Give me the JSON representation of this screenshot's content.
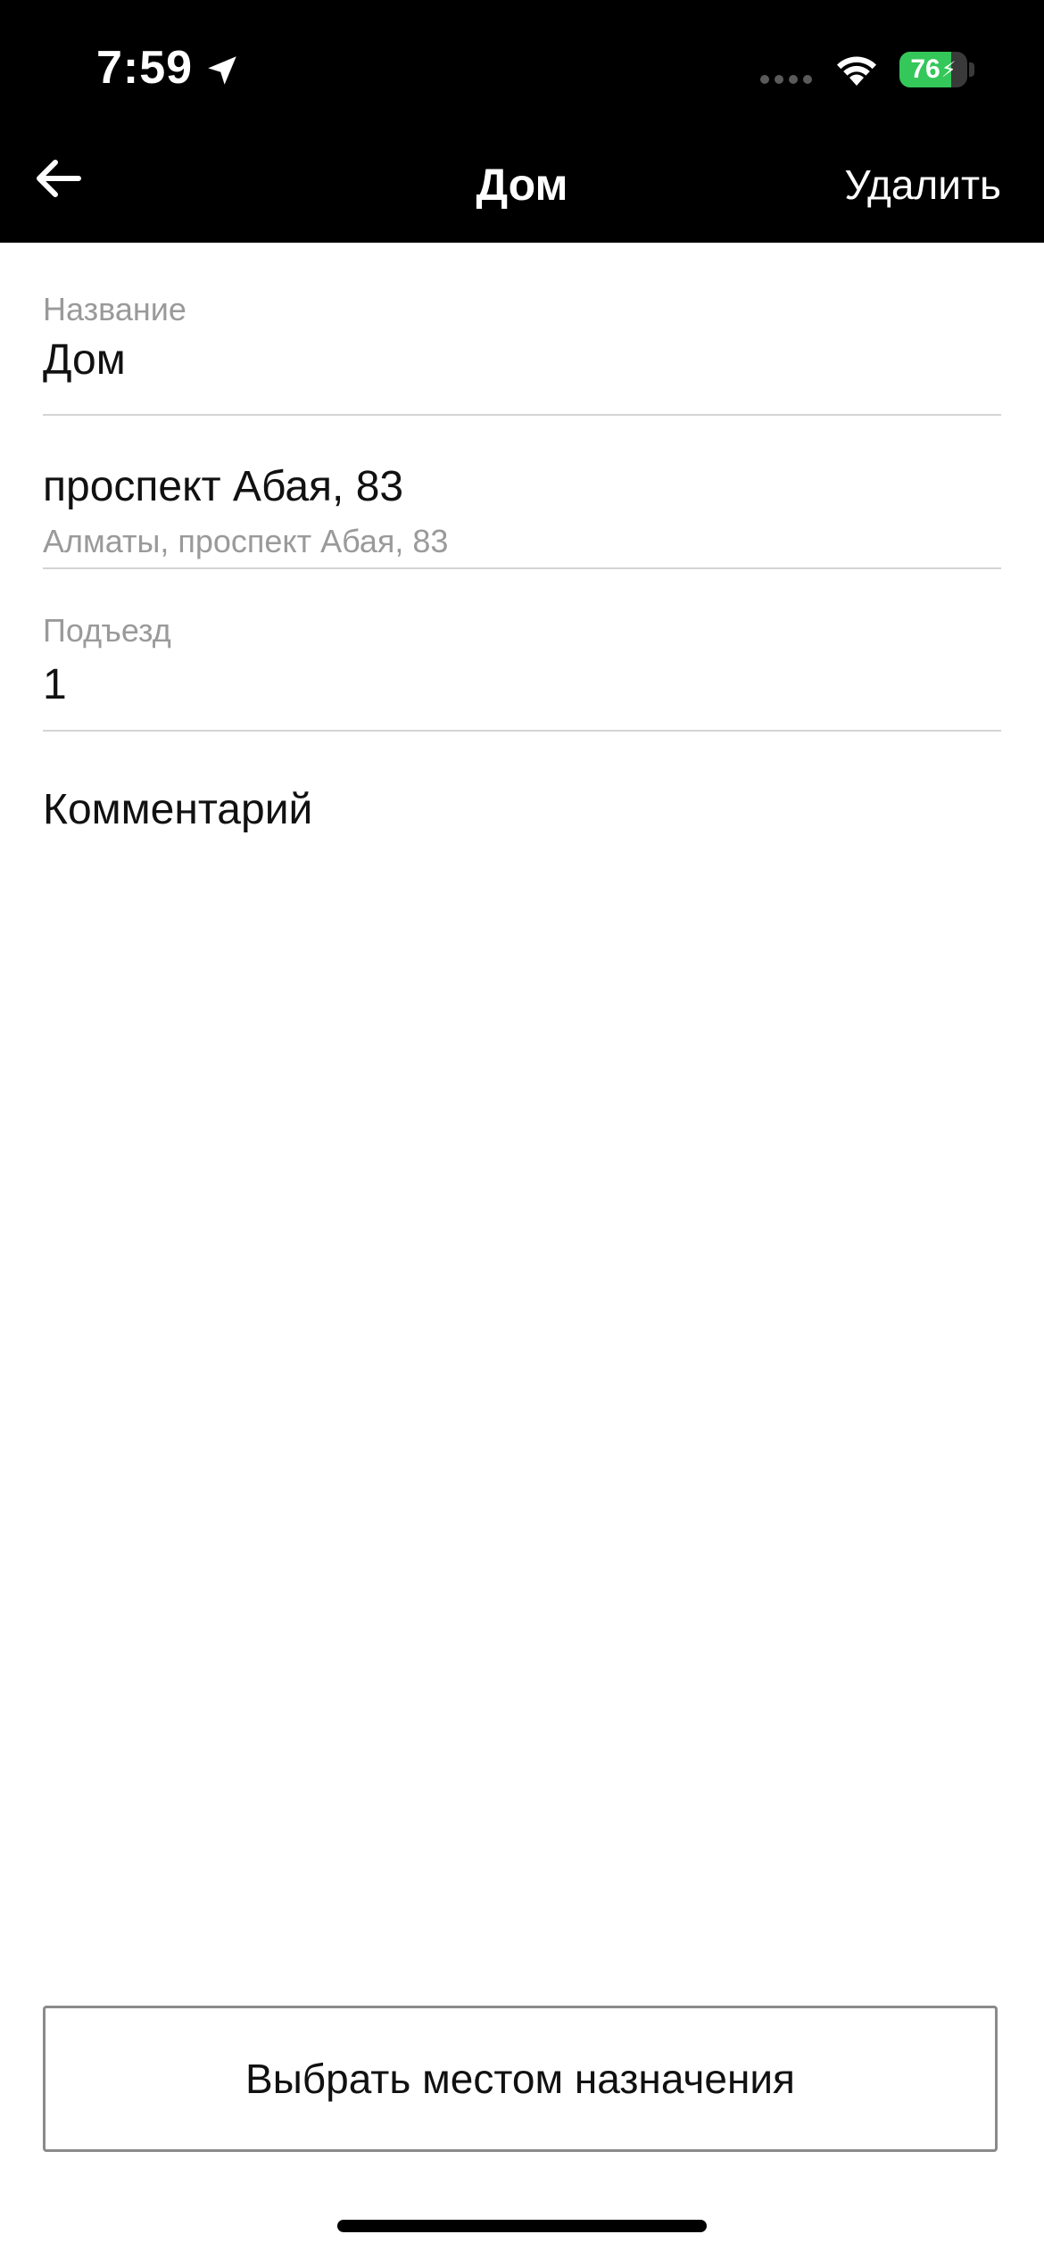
{
  "status_bar": {
    "time": "7:59",
    "battery_level": "76",
    "battery_fraction": 0.76,
    "location_icon": "location-arrow-icon",
    "wifi_icon": "wifi-icon"
  },
  "nav": {
    "back_icon": "arrow-left-icon",
    "title": "Дом",
    "delete_label": "Удалить"
  },
  "form": {
    "name": {
      "label": "Название",
      "value": "Дом"
    },
    "address": {
      "street": "проспект Абая, 83",
      "full": "Алматы, проспект Абая, 83"
    },
    "entrance": {
      "label": "Подъезд",
      "value": "1"
    },
    "comment": {
      "placeholder": "Комментарий"
    }
  },
  "actions": {
    "choose_destination_label": "Выбрать местом назначения"
  },
  "colors": {
    "header_bg": "#000000",
    "battery_green": "#34c759",
    "label_gray": "#9a9a9a",
    "divider": "#d4d4d4"
  }
}
